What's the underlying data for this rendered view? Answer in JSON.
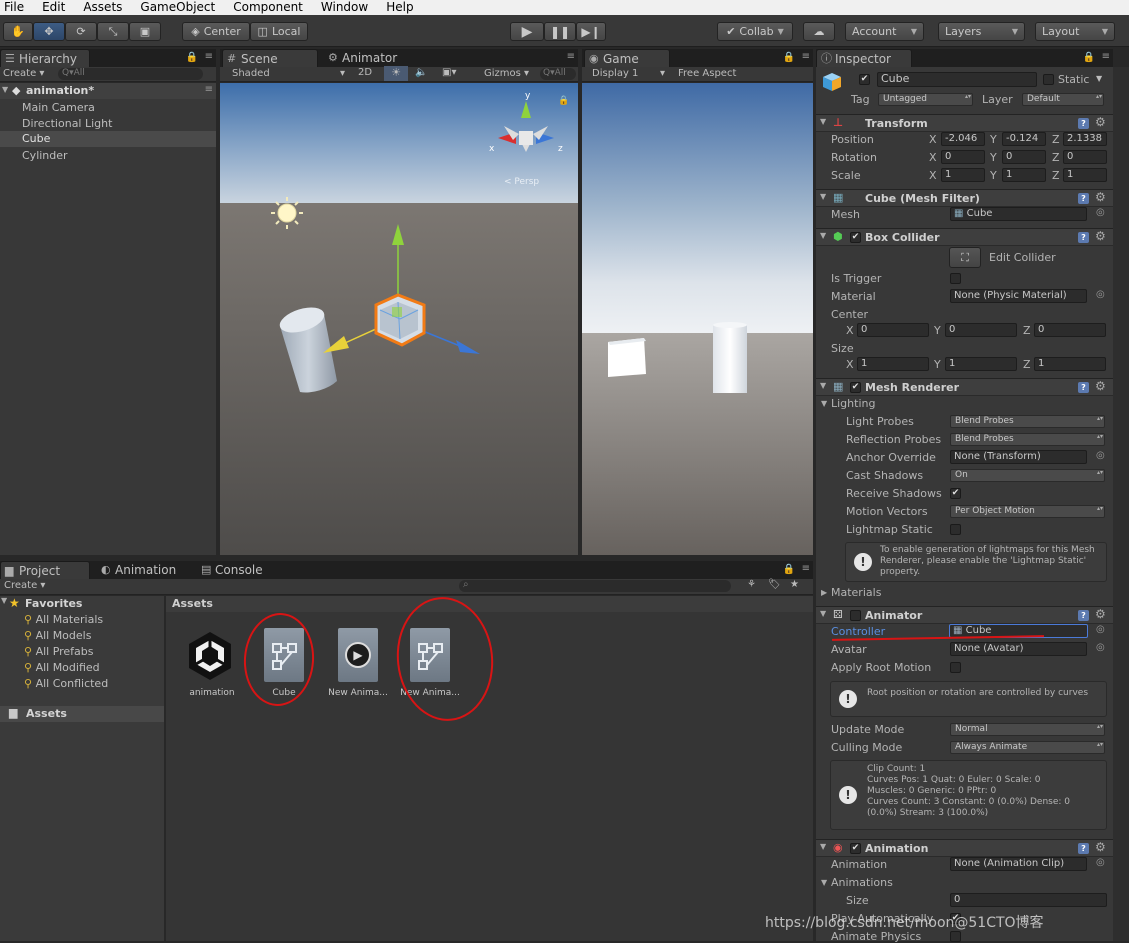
{
  "menu": [
    "File",
    "Edit",
    "Assets",
    "GameObject",
    "Component",
    "Window",
    "Help"
  ],
  "toolbar": {
    "pivot": "Center",
    "space": "Local",
    "collab": "Collab",
    "account": "Account",
    "layers": "Layers",
    "layout": "Layout"
  },
  "hierarchy": {
    "tab": "Hierarchy",
    "create": "Create",
    "search": "Q▾All",
    "scene": "animation*",
    "items": [
      "Main Camera",
      "Directional Light",
      "Cube",
      "Cylinder"
    ],
    "selected": "Cube"
  },
  "scene": {
    "tabs": [
      "Scene",
      "Animator"
    ],
    "shaded": "Shaded",
    "mode2d": "2D",
    "gizmos": "Gizmos",
    "search": "Q▾All",
    "axes": {
      "y": "y",
      "x": "x",
      "z": "z"
    },
    "persp": "< Persp"
  },
  "game": {
    "tab": "Game",
    "display": "Display 1",
    "aspect": "Free Aspect"
  },
  "inspector": {
    "tab": "Inspector",
    "object_name": "Cube",
    "static_label": "Static",
    "tag_label": "Tag",
    "tag_value": "Untagged",
    "layer_label": "Layer",
    "layer_value": "Default",
    "transform": {
      "title": "Transform",
      "position_label": "Position",
      "rotation_label": "Rotation",
      "scale_label": "Scale",
      "position": [
        "-2.046",
        "-0.124",
        "2.1338"
      ],
      "rotation": [
        "0",
        "0",
        "0"
      ],
      "scale": [
        "1",
        "1",
        "1"
      ]
    },
    "mesh_filter": {
      "title": "Cube (Mesh Filter)",
      "mesh_label": "Mesh",
      "mesh_value": "Cube"
    },
    "box_collider": {
      "title": "Box Collider",
      "edit": "Edit Collider",
      "is_trigger": "Is Trigger",
      "material_label": "Material",
      "material_value": "None (Physic Material)",
      "center_label": "Center",
      "center": [
        "0",
        "0",
        "0"
      ],
      "size_label": "Size",
      "size": [
        "1",
        "1",
        "1"
      ]
    },
    "mesh_renderer": {
      "title": "Mesh Renderer",
      "lighting": "Lighting",
      "light_probes_label": "Light Probes",
      "light_probes": "Blend Probes",
      "reflection_probes_label": "Reflection Probes",
      "reflection_probes": "Blend Probes",
      "anchor_override_label": "Anchor Override",
      "anchor_override": "None (Transform)",
      "cast_shadows_label": "Cast Shadows",
      "cast_shadows": "On",
      "receive_shadows_label": "Receive Shadows",
      "motion_vectors_label": "Motion Vectors",
      "motion_vectors": "Per Object Motion",
      "lightmap_static_label": "Lightmap Static",
      "info": "To enable generation of lightmaps for this Mesh Renderer, please enable the 'Lightmap Static' property.",
      "materials": "Materials"
    },
    "animator": {
      "title": "Animator",
      "controller_label": "Controller",
      "controller_value": "Cube",
      "avatar_label": "Avatar",
      "avatar_value": "None (Avatar)",
      "apply_root_motion": "Apply Root Motion",
      "info": "Root position or rotation are controlled by curves",
      "update_mode_label": "Update Mode",
      "update_mode": "Normal",
      "culling_mode_label": "Culling Mode",
      "culling_mode": "Always Animate",
      "stats": [
        "Clip Count: 1",
        "Curves Pos: 1 Quat: 0 Euler: 0 Scale: 0",
        "Muscles: 0 Generic: 0 PPtr: 0",
        "Curves Count: 3 Constant: 0 (0.0%) Dense: 0",
        "(0.0%) Stream: 3 (100.0%)"
      ]
    },
    "animation": {
      "title": "Animation",
      "animation_label": "Animation",
      "animation_value": "None (Animation Clip)",
      "animations_label": "Animations",
      "size_label": "Size",
      "size_value": "0",
      "play_auto": "Play Automatically",
      "animate_physics": "Animate Physics"
    }
  },
  "project": {
    "tabs": [
      "Project",
      "Animation",
      "Console"
    ],
    "create": "Create",
    "favorites": "Favorites",
    "fav_items": [
      "All Materials",
      "All Models",
      "All Prefabs",
      "All Modified",
      "All Conflicted"
    ],
    "assets_root": "Assets",
    "assets_title": "Assets",
    "assets": [
      "animation",
      "Cube",
      "New Anima...",
      "New Anima..."
    ]
  },
  "watermark": "https://blog.csdn.net/moon@51CTO博客"
}
